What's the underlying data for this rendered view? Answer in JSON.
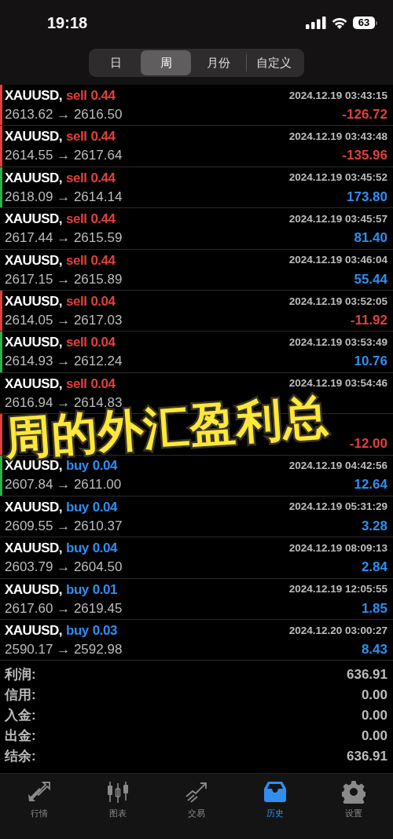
{
  "status_bar": {
    "time": "19:18",
    "battery": "63"
  },
  "segments": [
    {
      "label": "日",
      "selected": false
    },
    {
      "label": "周",
      "selected": true
    },
    {
      "label": "月份",
      "selected": false
    },
    {
      "label": "自定义",
      "selected": false
    }
  ],
  "deals": [
    {
      "symbol": "XAUUSD,",
      "side": "sell",
      "volume": "0.44",
      "time": "2024.12.19 03:43:15",
      "prices": "2613.62 → 2616.50",
      "profit": "-126.72",
      "negative": true,
      "color": "#e0413a"
    },
    {
      "symbol": "XAUUSD,",
      "side": "sell",
      "volume": "0.44",
      "time": "2024.12.19 03:43:48",
      "prices": "2614.55 → 2617.64",
      "profit": "-135.96",
      "negative": true,
      "color": "#e0413a"
    },
    {
      "symbol": "XAUUSD,",
      "side": "sell",
      "volume": "0.44",
      "time": "2024.12.19 03:45:52",
      "prices": "2618.09 → 2614.14",
      "profit": "173.80",
      "negative": false,
      "color": "#2fb14a"
    },
    {
      "symbol": "XAUUSD,",
      "side": "sell",
      "volume": "0.44",
      "time": "2024.12.19 03:45:57",
      "prices": "2617.44 → 2615.59",
      "profit": "81.40",
      "negative": false
    },
    {
      "symbol": "XAUUSD,",
      "side": "sell",
      "volume": "0.44",
      "time": "2024.12.19 03:46:04",
      "prices": "2617.15 → 2615.89",
      "profit": "55.44",
      "negative": false
    },
    {
      "symbol": "XAUUSD,",
      "side": "sell",
      "volume": "0.04",
      "time": "2024.12.19 03:52:05",
      "prices": "2614.05 → 2617.03",
      "profit": "-11.92",
      "negative": true,
      "color": "#e0413a"
    },
    {
      "symbol": "XAUUSD,",
      "side": "sell",
      "volume": "0.04",
      "time": "2024.12.19 03:53:49",
      "prices": "2614.93 → 2612.24",
      "profit": "10.76",
      "negative": false,
      "color": "#2fb14a"
    },
    {
      "symbol": "XAUUSD,",
      "side": "sell",
      "volume": "0.04",
      "time": "2024.12.19 03:54:46",
      "prices": "2616.94 → 2614.83"
    },
    {
      "profit": "-12.00",
      "negative": true,
      "color": "#e0413a"
    },
    {
      "symbol": "XAUUSD,",
      "side": "buy",
      "volume": "0.04",
      "time": "2024.12.19 04:42:56",
      "prices": "2607.84 → 2611.00",
      "profit": "12.64",
      "negative": false,
      "color": "#2fb14a"
    },
    {
      "symbol": "XAUUSD,",
      "side": "buy",
      "volume": "0.04",
      "time": "2024.12.19 05:31:29",
      "prices": "2609.55 → 2610.37",
      "profit": "3.28",
      "negative": false
    },
    {
      "symbol": "XAUUSD,",
      "side": "buy",
      "volume": "0.04",
      "time": "2024.12.19 08:09:13",
      "prices": "2603.79 → 2604.50",
      "profit": "2.84",
      "negative": false
    },
    {
      "symbol": "XAUUSD,",
      "side": "buy",
      "volume": "0.01",
      "time": "2024.12.19 12:05:55",
      "prices": "2617.60 → 2619.45",
      "profit": "1.85",
      "negative": false
    },
    {
      "symbol": "XAUUSD,",
      "side": "buy",
      "volume": "0.03",
      "time": "2024.12.20 03:00:27",
      "prices": "2590.17 → 2592.98",
      "profit": "8.43",
      "negative": false
    }
  ],
  "summary": [
    {
      "label": "利润:",
      "value": "636.91"
    },
    {
      "label": "信用:",
      "value": "0.00"
    },
    {
      "label": "入金:",
      "value": "0.00"
    },
    {
      "label": "出金:",
      "value": "0.00"
    },
    {
      "label": "结余:",
      "value": "636.91"
    }
  ],
  "overlay_caption": "周的外汇盈利总",
  "tab_bar": [
    {
      "label": "行情",
      "kind": "quotes",
      "selected": false
    },
    {
      "label": "图表",
      "kind": "chart",
      "selected": false
    },
    {
      "label": "交易",
      "kind": "trade",
      "selected": false
    },
    {
      "label": "历史",
      "kind": "history",
      "selected": true
    },
    {
      "label": "设置",
      "kind": "settings",
      "selected": false
    }
  ]
}
